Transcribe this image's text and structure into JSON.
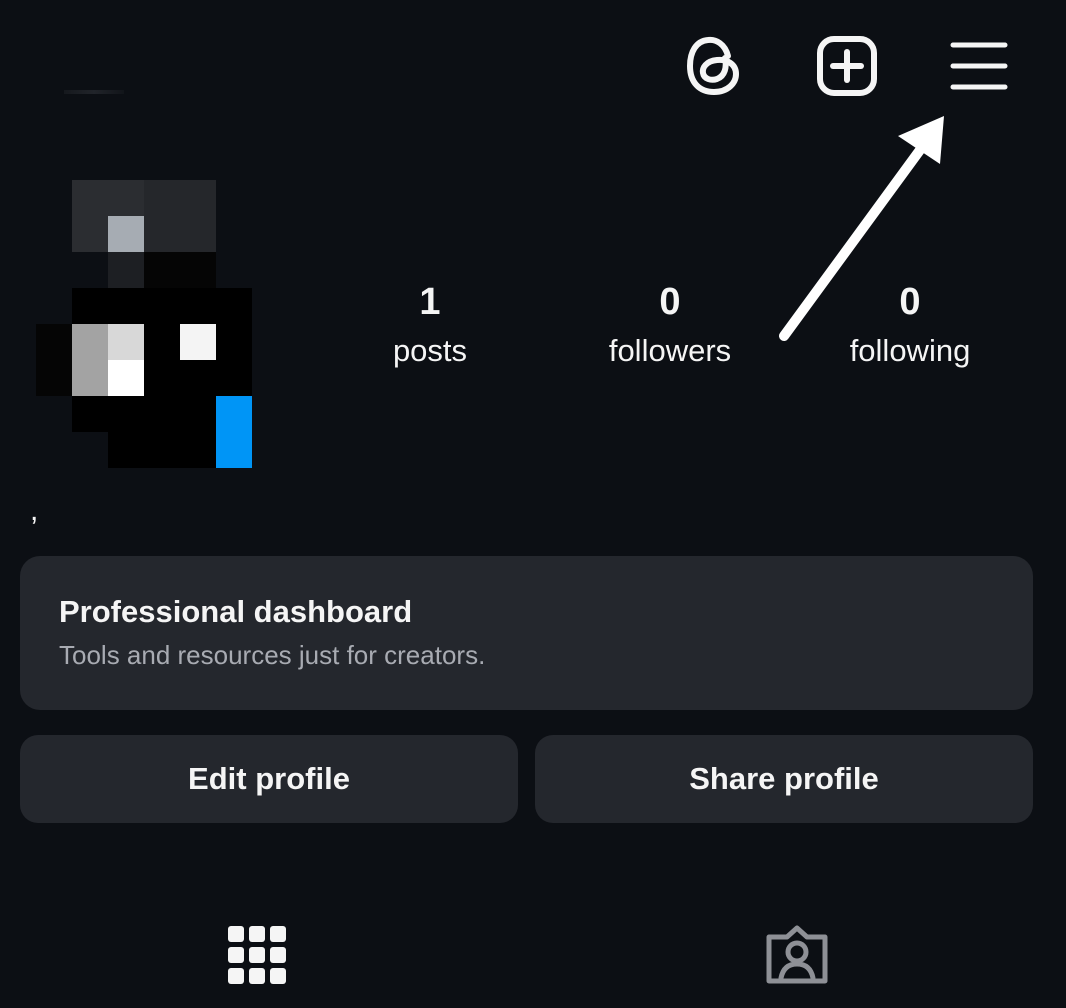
{
  "header": {
    "icons": [
      "threads-icon",
      "create-post-icon",
      "menu-icon"
    ]
  },
  "profile": {
    "name_text": ","
  },
  "stats": [
    {
      "value": "1",
      "label": "posts"
    },
    {
      "value": "0",
      "label": "followers"
    },
    {
      "value": "0",
      "label": "following"
    }
  ],
  "dashboard": {
    "title": "Professional dashboard",
    "subtitle": "Tools and resources just for creators."
  },
  "actions": {
    "edit_label": "Edit profile",
    "share_label": "Share profile"
  },
  "tabs": {
    "icons": [
      "grid-icon",
      "tagged-icon"
    ],
    "active": "grid-icon"
  },
  "colors": {
    "background": "#0c0f14",
    "card": "#24272d",
    "text": "#f5f5f5",
    "muted": "#a8abb2",
    "avatar_accent": "#0095f6"
  }
}
